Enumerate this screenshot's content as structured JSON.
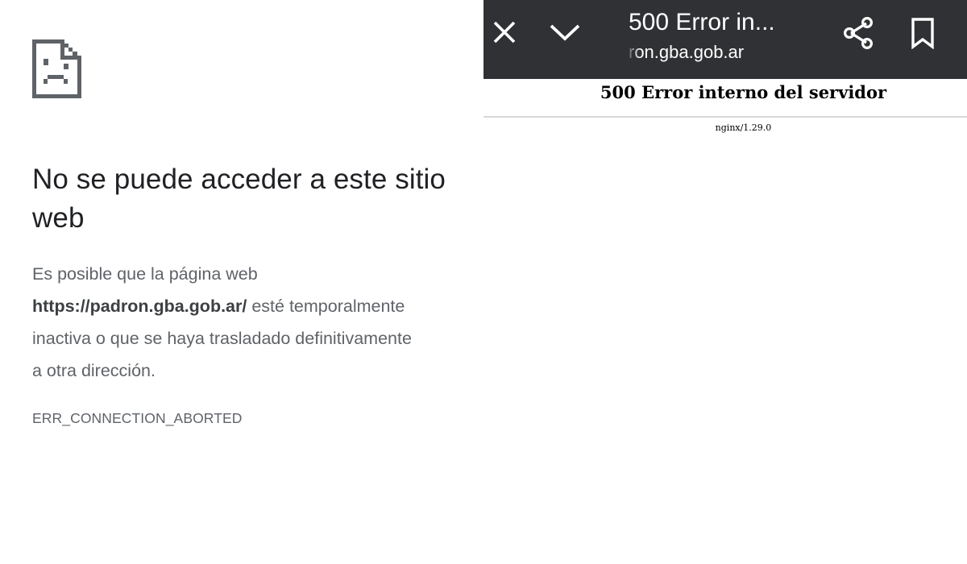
{
  "left_error_page": {
    "icon": "sad-document-icon",
    "title": "No se puede acceder a este sitio web",
    "description_line1": "Es posible que la página web",
    "url": "https://padron.gba.gob.ar/",
    "description_line2_rest": " esté temporalmente",
    "description_line3": "inactiva o que se haya trasladado definitivamente",
    "description_line4": "a otra dirección.",
    "error_code": "ERR_CONNECTION_ABORTED"
  },
  "custom_tab": {
    "toolbar": {
      "background_color": "#303134",
      "close_icon": "close-icon",
      "expand_icon": "chevron-down-icon",
      "title": "500 Error in...",
      "url": "ron.gba.gob.ar",
      "share_icon": "share-icon",
      "bookmark_icon": "bookmark-icon"
    },
    "page": {
      "heading": "500 Error interno del servidor",
      "server": "nginx/1.29.0"
    }
  }
}
